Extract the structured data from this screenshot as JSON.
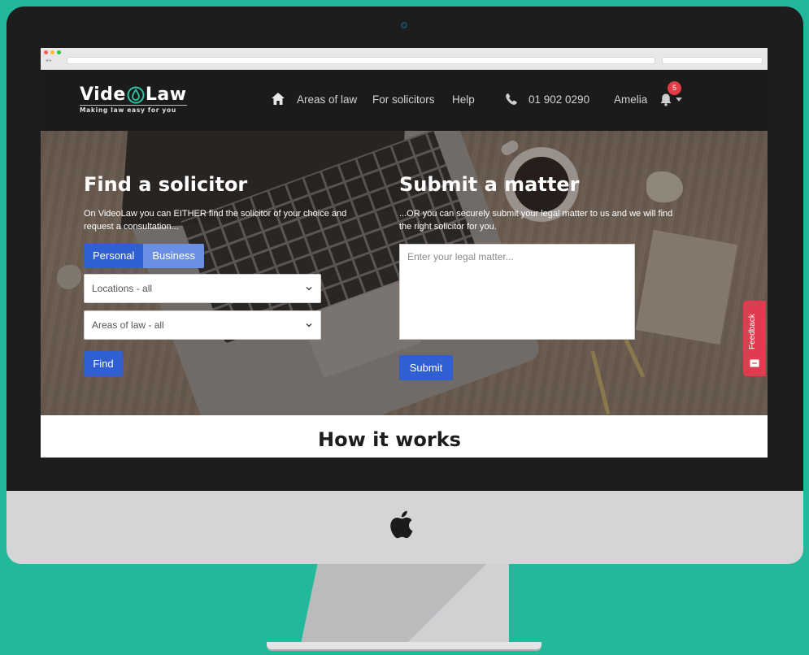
{
  "site": {
    "logo_left": "Vide",
    "logo_right": "Law",
    "tagline": "Making law easy for you"
  },
  "nav": {
    "items": [
      "Areas of law",
      "For solicitors",
      "Help"
    ],
    "phone": "01 902 0290",
    "user": "Amelia",
    "notifications": "5"
  },
  "find": {
    "title": "Find a solicitor",
    "text": "On VideoLaw you can EITHER find the solicitor of your choice and request a consultation...",
    "toggle": [
      "Personal",
      "Business"
    ],
    "location_select": "Locations - all",
    "area_select": "Areas of law - all",
    "button": "Find"
  },
  "submit": {
    "title": "Submit a matter",
    "text": "...OR you can securely submit your legal matter to us and we will find the right solicitor for you.",
    "placeholder": "Enter your legal matter...",
    "button": "Submit"
  },
  "feedback": "Feedback",
  "how_it_works": "How it works",
  "colors": {
    "background": "#22b89a",
    "primary_button": "#2f5fd0",
    "secondary_toggle": "#6c8fe6",
    "feedback": "#e03c4f",
    "header": "#1b1b1b"
  }
}
